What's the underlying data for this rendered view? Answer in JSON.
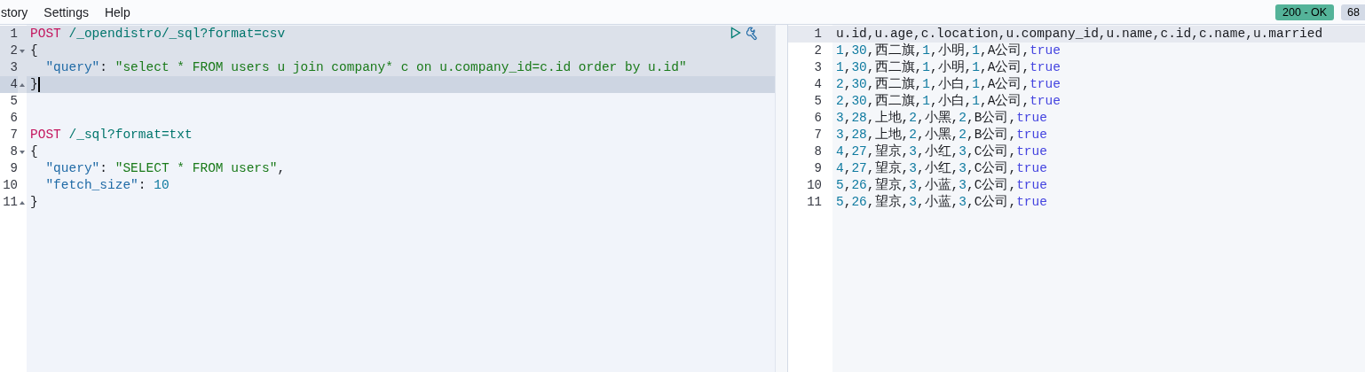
{
  "menu": [
    {
      "label": "story"
    },
    {
      "label": "Settings"
    },
    {
      "label": "Help"
    }
  ],
  "status": {
    "badge": "200 - OK",
    "time": "68"
  },
  "editor": {
    "lines": [
      {
        "number": "1",
        "fold_start": false,
        "fold_end": false,
        "highlighted": true,
        "current": false,
        "cursor": false,
        "tokens": [
          {
            "kind": "method",
            "text": "POST"
          },
          {
            "kind": "url",
            "text": "/_opendistro/_sql?format=csv"
          }
        ]
      },
      {
        "number": "2",
        "fold_start": true,
        "fold_end": false,
        "highlighted": true,
        "current": false,
        "cursor": false,
        "tokens": [
          {
            "kind": "plain",
            "text": "{"
          }
        ]
      },
      {
        "number": "3",
        "fold_start": false,
        "fold_end": false,
        "highlighted": true,
        "current": false,
        "cursor": false,
        "tokens": [
          {
            "kind": "key",
            "text": "\"query\""
          },
          {
            "kind": "plain",
            "text": ": "
          },
          {
            "kind": "string",
            "text": "\"select * FROM users u join company* c on u.company_id=c.id order by u.id\""
          }
        ]
      },
      {
        "number": "4",
        "fold_start": false,
        "fold_end": true,
        "highlighted": true,
        "current": true,
        "cursor": true,
        "tokens": [
          {
            "kind": "plain",
            "text": "}"
          }
        ]
      },
      {
        "number": "5",
        "fold_start": false,
        "fold_end": false,
        "highlighted": false,
        "current": false,
        "cursor": false
      },
      {
        "number": "6",
        "fold_start": false,
        "fold_end": false,
        "highlighted": false,
        "current": false,
        "cursor": false
      },
      {
        "number": "7",
        "fold_start": false,
        "fold_end": false,
        "highlighted": false,
        "current": false,
        "cursor": false,
        "tokens": [
          {
            "kind": "method",
            "text": "POST"
          },
          {
            "kind": "url",
            "text": "/_sql?format=txt"
          }
        ]
      },
      {
        "number": "8",
        "fold_start": true,
        "fold_end": false,
        "highlighted": false,
        "current": false,
        "cursor": false,
        "tokens": [
          {
            "kind": "plain",
            "text": "{"
          }
        ]
      },
      {
        "number": "9",
        "fold_start": false,
        "fold_end": false,
        "highlighted": false,
        "current": false,
        "cursor": false,
        "tokens": [
          {
            "kind": "key",
            "text": "\"query\""
          },
          {
            "kind": "plain",
            "text": ": "
          },
          {
            "kind": "string",
            "text": "\"SELECT * FROM users\""
          },
          {
            "kind": "plain",
            "text": ","
          }
        ]
      },
      {
        "number": "10",
        "fold_start": false,
        "fold_end": false,
        "highlighted": false,
        "current": false,
        "cursor": false,
        "tokens": [
          {
            "kind": "key",
            "text": "\"fetch_size\""
          },
          {
            "kind": "plain",
            "text": ": "
          },
          {
            "kind": "number",
            "text": "10"
          }
        ]
      },
      {
        "number": "11",
        "fold_start": false,
        "fold_end": true,
        "highlighted": false,
        "current": false,
        "cursor": false,
        "tokens": [
          {
            "kind": "plain",
            "text": "}"
          }
        ]
      }
    ]
  },
  "output": {
    "lines": [
      {
        "number": "1",
        "active": true,
        "tokens": [
          {
            "kind": "plain",
            "text": "u.id,u.age,c.location,u.company_id,u.name,c.id,c.name,u.married"
          }
        ]
      },
      {
        "number": "2",
        "active": false,
        "tokens": [
          {
            "kind": "number",
            "text": "1"
          },
          {
            "kind": "plain",
            "text": ","
          },
          {
            "kind": "number",
            "text": "30"
          },
          {
            "kind": "plain",
            "text": ",西二旗,"
          },
          {
            "kind": "number",
            "text": "1"
          },
          {
            "kind": "plain",
            "text": ",小明,"
          },
          {
            "kind": "number",
            "text": "1"
          },
          {
            "kind": "plain",
            "text": ",A公司,"
          },
          {
            "kind": "bool",
            "text": "true"
          }
        ]
      },
      {
        "number": "3",
        "active": false,
        "tokens": [
          {
            "kind": "number",
            "text": "1"
          },
          {
            "kind": "plain",
            "text": ","
          },
          {
            "kind": "number",
            "text": "30"
          },
          {
            "kind": "plain",
            "text": ",西二旗,"
          },
          {
            "kind": "number",
            "text": "1"
          },
          {
            "kind": "plain",
            "text": ",小明,"
          },
          {
            "kind": "number",
            "text": "1"
          },
          {
            "kind": "plain",
            "text": ",A公司,"
          },
          {
            "kind": "bool",
            "text": "true"
          }
        ]
      },
      {
        "number": "4",
        "active": false,
        "tokens": [
          {
            "kind": "number",
            "text": "2"
          },
          {
            "kind": "plain",
            "text": ","
          },
          {
            "kind": "number",
            "text": "30"
          },
          {
            "kind": "plain",
            "text": ",西二旗,"
          },
          {
            "kind": "number",
            "text": "1"
          },
          {
            "kind": "plain",
            "text": ",小白,"
          },
          {
            "kind": "number",
            "text": "1"
          },
          {
            "kind": "plain",
            "text": ",A公司,"
          },
          {
            "kind": "bool",
            "text": "true"
          }
        ]
      },
      {
        "number": "5",
        "active": false,
        "tokens": [
          {
            "kind": "number",
            "text": "2"
          },
          {
            "kind": "plain",
            "text": ","
          },
          {
            "kind": "number",
            "text": "30"
          },
          {
            "kind": "plain",
            "text": ",西二旗,"
          },
          {
            "kind": "number",
            "text": "1"
          },
          {
            "kind": "plain",
            "text": ",小白,"
          },
          {
            "kind": "number",
            "text": "1"
          },
          {
            "kind": "plain",
            "text": ",A公司,"
          },
          {
            "kind": "bool",
            "text": "true"
          }
        ]
      },
      {
        "number": "6",
        "active": false,
        "tokens": [
          {
            "kind": "number",
            "text": "3"
          },
          {
            "kind": "plain",
            "text": ","
          },
          {
            "kind": "number",
            "text": "28"
          },
          {
            "kind": "plain",
            "text": ",上地,"
          },
          {
            "kind": "number",
            "text": "2"
          },
          {
            "kind": "plain",
            "text": ",小黑,"
          },
          {
            "kind": "number",
            "text": "2"
          },
          {
            "kind": "plain",
            "text": ",B公司,"
          },
          {
            "kind": "bool",
            "text": "true"
          }
        ]
      },
      {
        "number": "7",
        "active": false,
        "tokens": [
          {
            "kind": "number",
            "text": "3"
          },
          {
            "kind": "plain",
            "text": ","
          },
          {
            "kind": "number",
            "text": "28"
          },
          {
            "kind": "plain",
            "text": ",上地,"
          },
          {
            "kind": "number",
            "text": "2"
          },
          {
            "kind": "plain",
            "text": ",小黑,"
          },
          {
            "kind": "number",
            "text": "2"
          },
          {
            "kind": "plain",
            "text": ",B公司,"
          },
          {
            "kind": "bool",
            "text": "true"
          }
        ]
      },
      {
        "number": "8",
        "active": false,
        "tokens": [
          {
            "kind": "number",
            "text": "4"
          },
          {
            "kind": "plain",
            "text": ","
          },
          {
            "kind": "number",
            "text": "27"
          },
          {
            "kind": "plain",
            "text": ",望京,"
          },
          {
            "kind": "number",
            "text": "3"
          },
          {
            "kind": "plain",
            "text": ",小红,"
          },
          {
            "kind": "number",
            "text": "3"
          },
          {
            "kind": "plain",
            "text": ",C公司,"
          },
          {
            "kind": "bool",
            "text": "true"
          }
        ]
      },
      {
        "number": "9",
        "active": false,
        "tokens": [
          {
            "kind": "number",
            "text": "4"
          },
          {
            "kind": "plain",
            "text": ","
          },
          {
            "kind": "number",
            "text": "27"
          },
          {
            "kind": "plain",
            "text": ",望京,"
          },
          {
            "kind": "number",
            "text": "3"
          },
          {
            "kind": "plain",
            "text": ",小红,"
          },
          {
            "kind": "number",
            "text": "3"
          },
          {
            "kind": "plain",
            "text": ",C公司,"
          },
          {
            "kind": "bool",
            "text": "true"
          }
        ]
      },
      {
        "number": "10",
        "active": false,
        "tokens": [
          {
            "kind": "number",
            "text": "5"
          },
          {
            "kind": "plain",
            "text": ","
          },
          {
            "kind": "number",
            "text": "26"
          },
          {
            "kind": "plain",
            "text": ",望京,"
          },
          {
            "kind": "number",
            "text": "3"
          },
          {
            "kind": "plain",
            "text": ",小蓝,"
          },
          {
            "kind": "number",
            "text": "3"
          },
          {
            "kind": "plain",
            "text": ",C公司,"
          },
          {
            "kind": "bool",
            "text": "true"
          }
        ]
      },
      {
        "number": "11",
        "active": false,
        "tokens": [
          {
            "kind": "number",
            "text": "5"
          },
          {
            "kind": "plain",
            "text": ","
          },
          {
            "kind": "number",
            "text": "26"
          },
          {
            "kind": "plain",
            "text": ",望京,"
          },
          {
            "kind": "number",
            "text": "3"
          },
          {
            "kind": "plain",
            "text": ",小蓝,"
          },
          {
            "kind": "number",
            "text": "3"
          },
          {
            "kind": "plain",
            "text": ",C公司,"
          },
          {
            "kind": "bool",
            "text": "true"
          }
        ]
      }
    ]
  }
}
